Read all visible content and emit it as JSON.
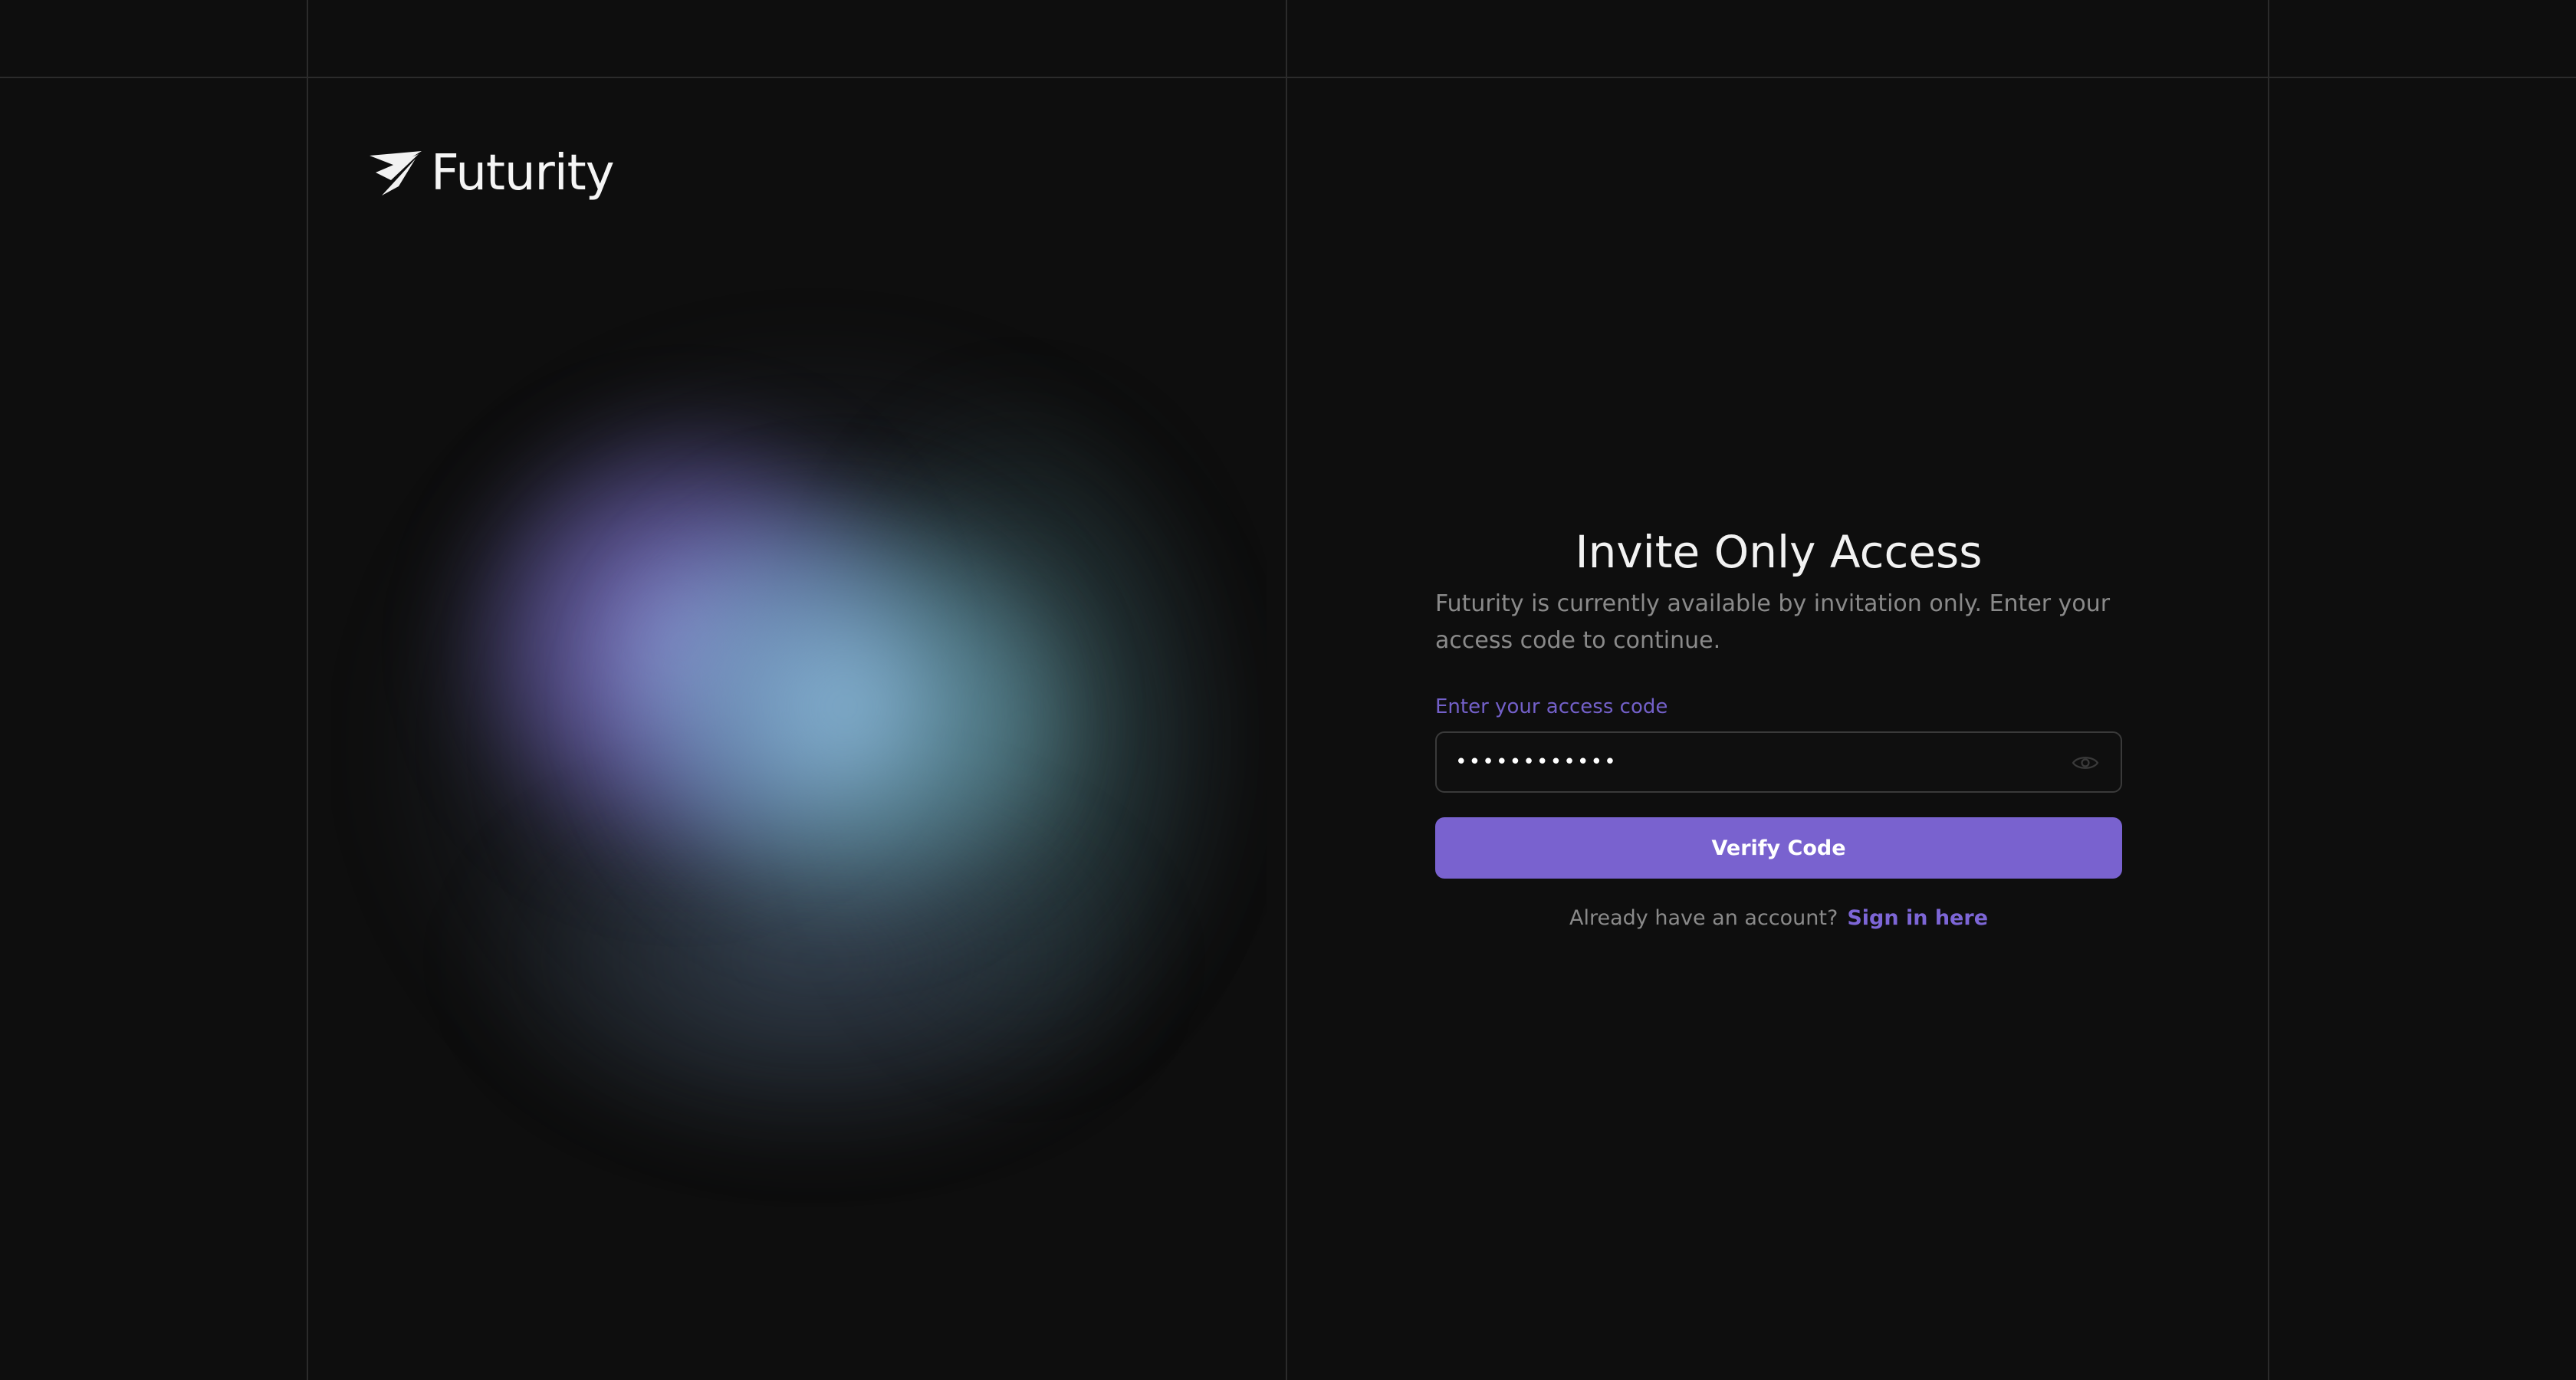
{
  "brand": {
    "name": "Futurity",
    "logo_icon": "futurity-wing-logo"
  },
  "form": {
    "title": "Invite Only Access",
    "subtitle": "Futurity is currently available by invitation only. Enter your access code to continue.",
    "access_code_label": "Enter your access code",
    "access_code_value": "••••••••••••",
    "visibility_toggle_icon": "eye-icon",
    "verify_button_label": "Verify Code",
    "signin_prompt": "Already have an account?",
    "signin_link_label": "Sign in here"
  },
  "colors": {
    "background": "#0e0e0e",
    "accent": "#7962cf",
    "label_accent": "#7360c9",
    "muted_text": "#8a8a8a",
    "frame_lines": "#2b2b2b"
  }
}
